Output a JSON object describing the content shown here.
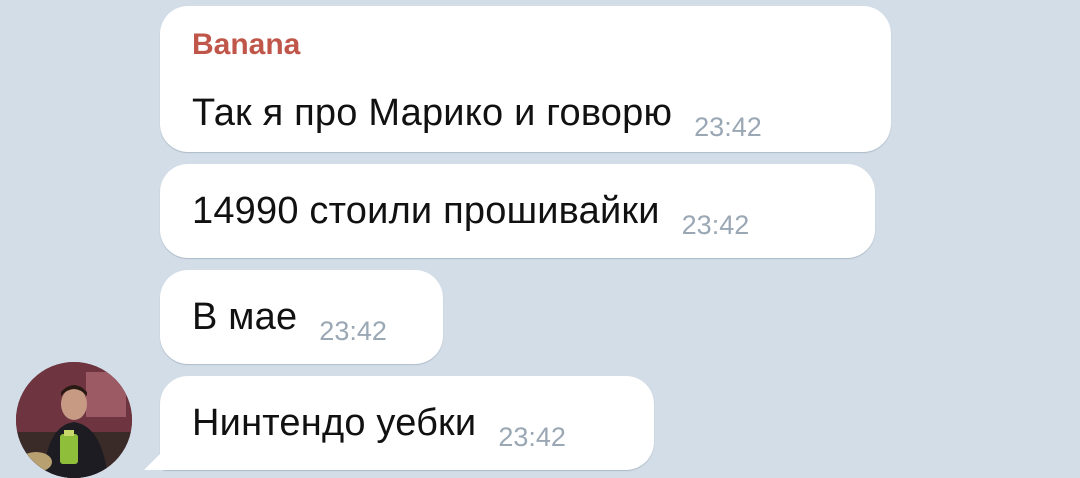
{
  "colors": {
    "background": "#d3dde7",
    "bubble": "#ffffff",
    "sender_name": "#c0564a",
    "message_text": "#111111",
    "timestamp": "#9aa7b4"
  },
  "messages": [
    {
      "sender": "Banana",
      "text": "Так я про Марико и говорю",
      "time": "23:42"
    },
    {
      "text": "14990 стоили прошивайки",
      "time": "23:42"
    },
    {
      "text": "В мае",
      "time": "23:42"
    },
    {
      "text": "Нинтендо уебки",
      "time": "23:42"
    }
  ],
  "avatar": {
    "icon": "user-photo-avatar"
  }
}
